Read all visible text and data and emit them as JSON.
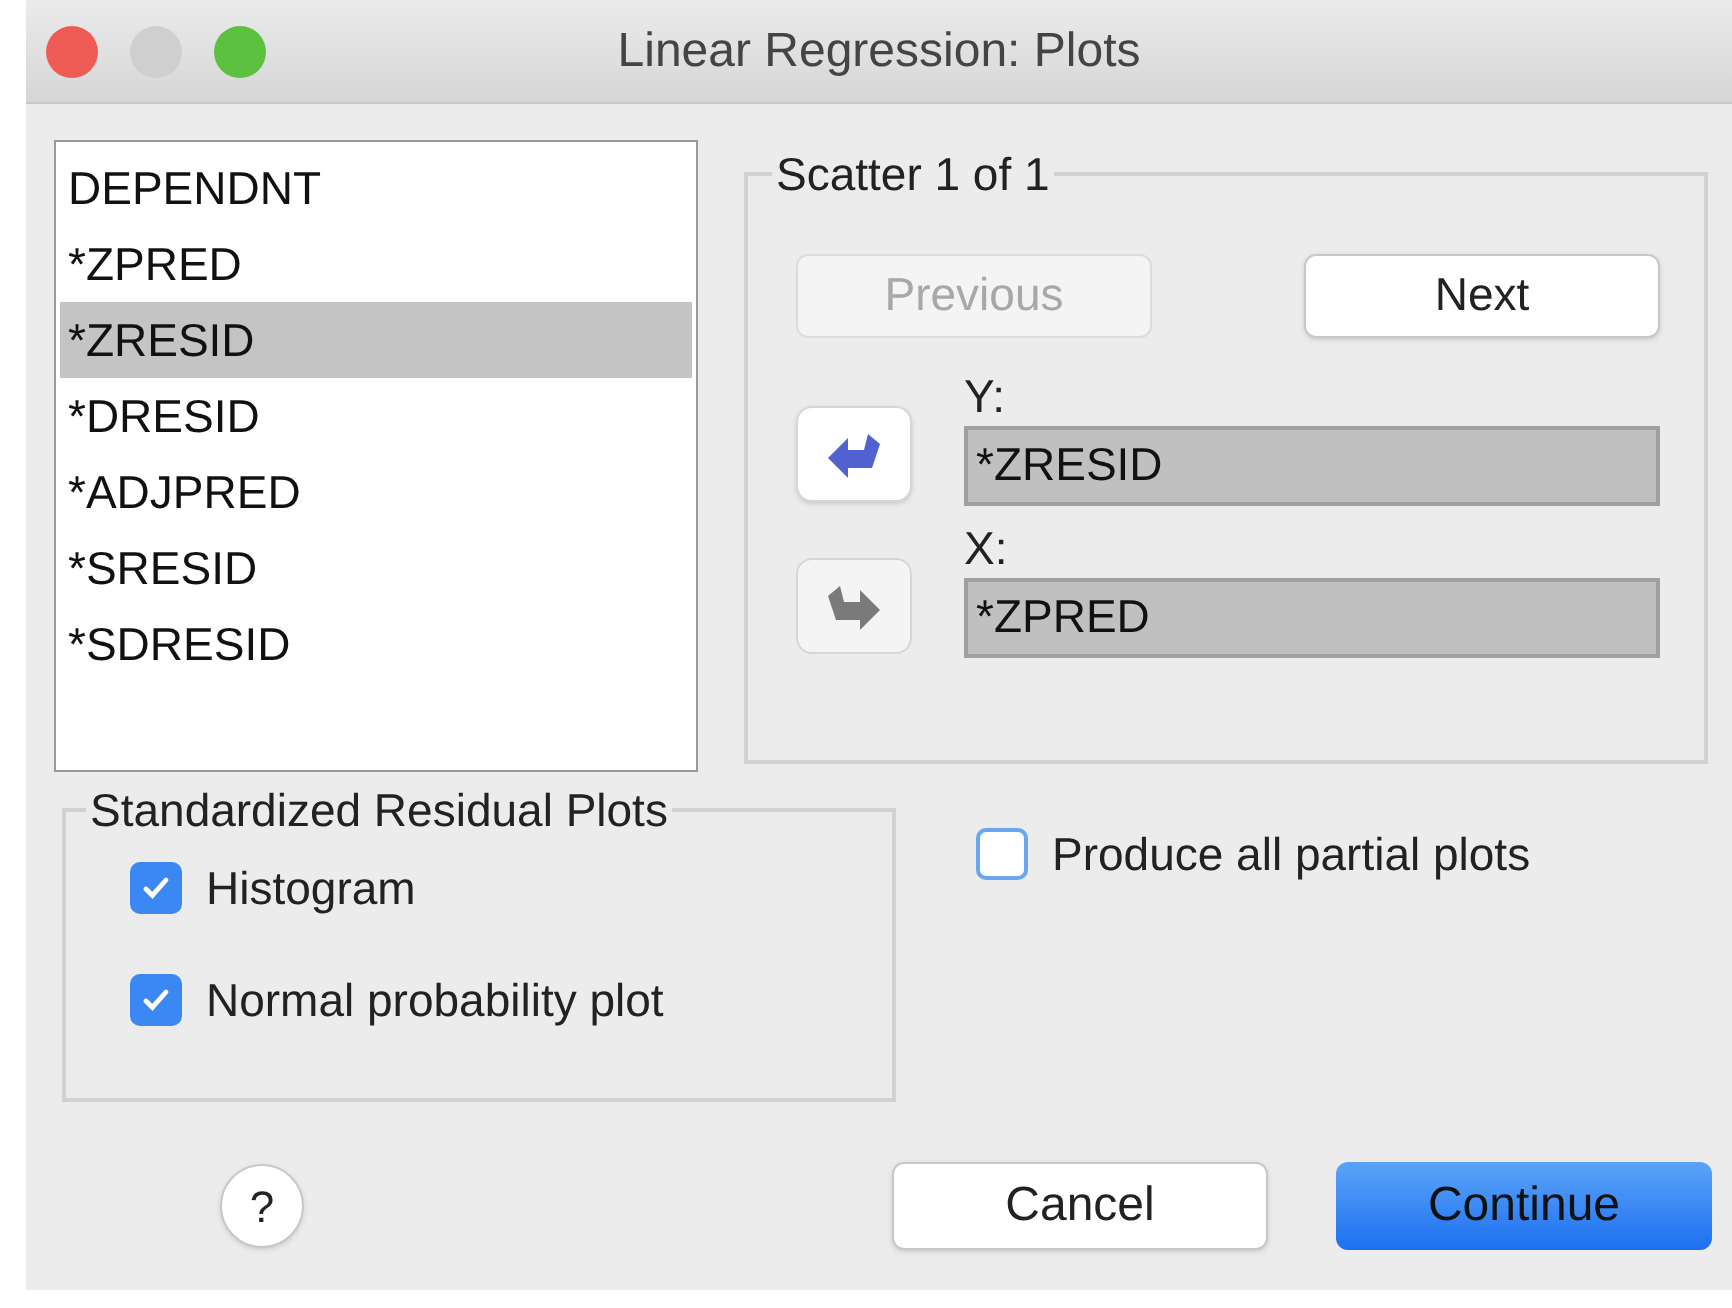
{
  "window": {
    "title": "Linear Regression: Plots"
  },
  "variables": [
    {
      "name": "DEPENDNT",
      "selected": false
    },
    {
      "name": "*ZPRED",
      "selected": false
    },
    {
      "name": "*ZRESID",
      "selected": true
    },
    {
      "name": "*DRESID",
      "selected": false
    },
    {
      "name": "*ADJPRED",
      "selected": false
    },
    {
      "name": "*SRESID",
      "selected": false
    },
    {
      "name": "*SDRESID",
      "selected": false
    }
  ],
  "scatter": {
    "title": "Scatter 1 of 1",
    "previous": {
      "label": "Previous",
      "disabled": true
    },
    "next": {
      "label": "Next",
      "disabled": false
    },
    "fields": [
      {
        "label": "Y:",
        "value": "*ZRESID",
        "arrow_disabled": false
      },
      {
        "label": "X:",
        "value": "*ZPRED",
        "arrow_disabled": true
      }
    ]
  },
  "standardized": {
    "title": "Standardized Residual Plots",
    "options": [
      {
        "label": "Histogram",
        "checked": true
      },
      {
        "label": "Normal probability plot",
        "checked": true
      }
    ]
  },
  "partial_plots": {
    "label": "Produce all partial plots",
    "checked": false
  },
  "help": "?",
  "buttons": [
    {
      "label": "Cancel",
      "kind": "secondary"
    },
    {
      "label": "Continue",
      "kind": "primary"
    }
  ]
}
